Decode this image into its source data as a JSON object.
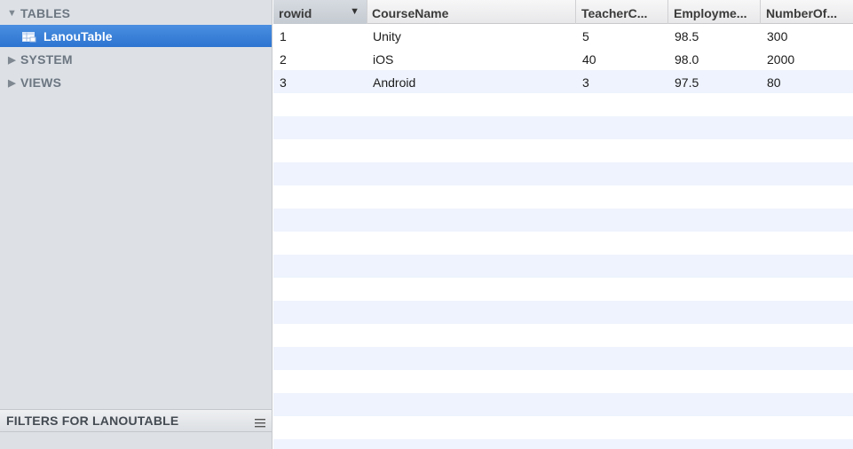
{
  "sidebar": {
    "tables_group": "TABLES",
    "selected_table": "LanouTable",
    "system_group": "SYSTEM",
    "views_group": "VIEWS",
    "filters_label": "FILTERS FOR LANOUTABLE"
  },
  "table": {
    "columns": [
      "rowid",
      "CourseName",
      "TeacherC...",
      "Employme...",
      "NumberOf..."
    ],
    "sorted_column": "rowid",
    "rows": [
      [
        "1",
        "Unity",
        "5",
        "98.5",
        "300"
      ],
      [
        "2",
        "iOS",
        "40",
        "98.0",
        "2000"
      ],
      [
        "3",
        "Android",
        "3",
        "97.5",
        "80"
      ]
    ]
  },
  "colors": {
    "selection": "#2d74d1",
    "row_alt": "#eef3fd",
    "sidebar_bg": "#dde1e6"
  },
  "icons": {
    "table": "table-icon",
    "disclosure_open": "triangle-down-icon",
    "disclosure_closed": "triangle-right-icon",
    "menu": "menu-lines-icon",
    "sort": "sort-descending-icon"
  }
}
